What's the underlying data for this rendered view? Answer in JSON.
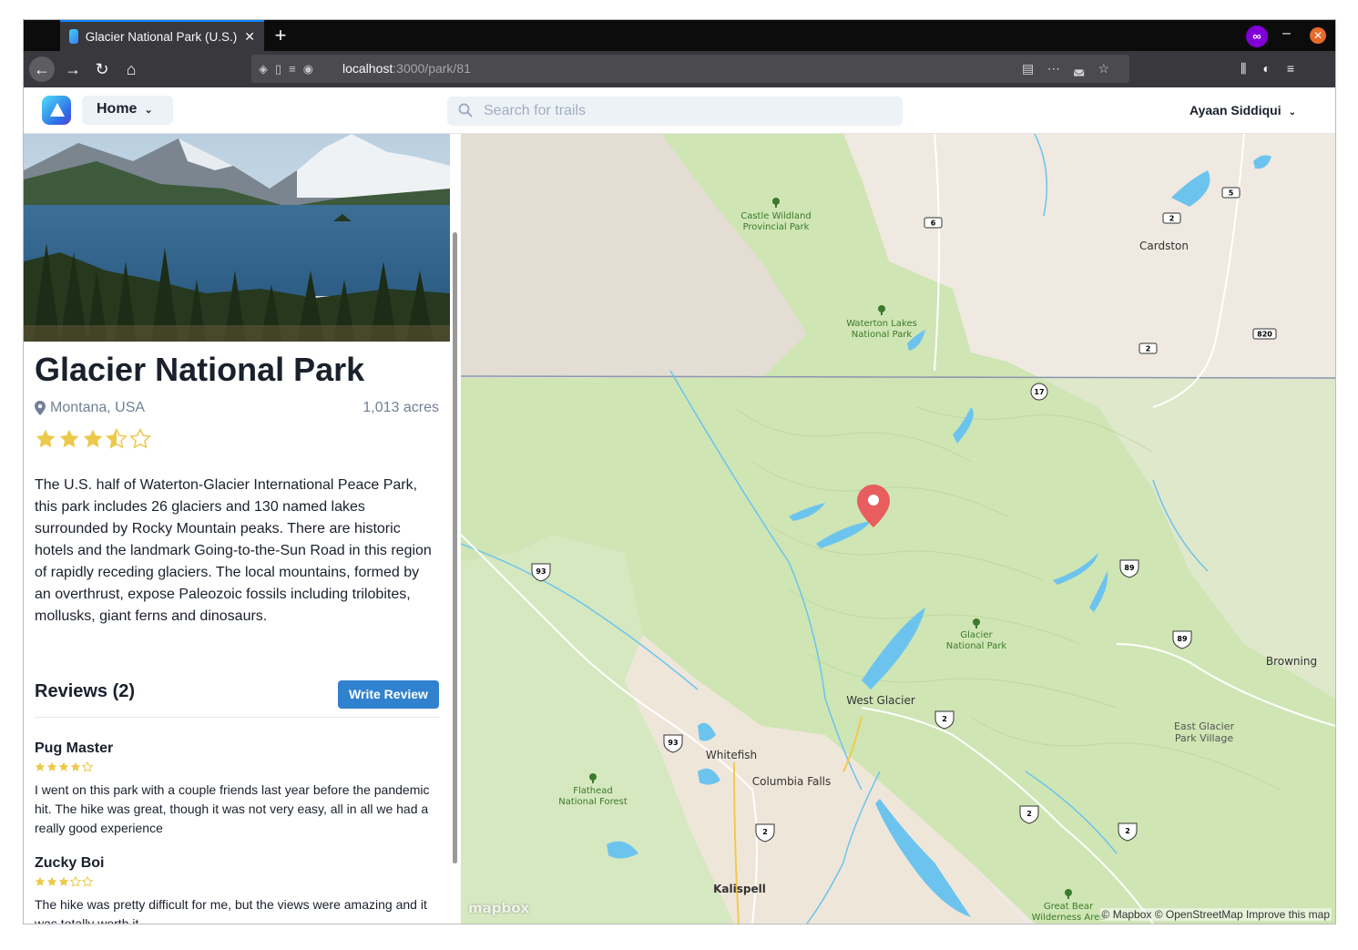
{
  "browser": {
    "tab_title": "Glacier National Park (U.S.)",
    "url_host": "localhost",
    "url_path": ":3000/park/81"
  },
  "header": {
    "home_label": "Home",
    "search_placeholder": "Search for trails",
    "user_name": "Ayaan Siddiqui"
  },
  "park": {
    "name": "Glacier National Park",
    "location": "Montana, USA",
    "acres": "1,013 acres",
    "rating": 3.5,
    "description": "The U.S. half of Waterton-Glacier International Peace Park, this park includes 26 glaciers and 130 named lakes surrounded by Rocky Mountain peaks. There are historic hotels and the landmark Going-to-the-Sun Road in this region of rapidly receding glaciers. The local mountains, formed by an overthrust, expose Paleozoic fossils including trilobites, mollusks, giant ferns and dinosaurs."
  },
  "reviews": {
    "heading": "Reviews (2)",
    "write_label": "Write Review",
    "items": [
      {
        "author": "Pug Master",
        "rating": 4,
        "text": "I went on this park with a couple friends last year before the pandemic hit. The hike was great, though it was not very easy, all in all we had a really good experience"
      },
      {
        "author": "Zucky Boi",
        "rating": 3,
        "text": "The hike was pretty difficult for me, but the views were amazing and it was totally worth it"
      }
    ]
  },
  "map": {
    "labels": {
      "castle": [
        "Castle Wildland",
        "Provincial Park"
      ],
      "waterton": [
        "Waterton Lakes",
        "National Park"
      ],
      "glacier": [
        "Glacier",
        "National Park"
      ],
      "flathead": [
        "Flathead",
        "National Forest"
      ],
      "greatbear": [
        "Great Bear",
        "Wilderness Area"
      ],
      "eastglacier": [
        "East Glacier",
        "Park Village"
      ],
      "cardston": "Cardston",
      "browning": "Browning",
      "westglacier": "West Glacier",
      "whitefish": "Whitefish",
      "columbiafalls": "Columbia Falls",
      "kalispell": "Kalispell"
    },
    "shields": [
      "6",
      "2",
      "5",
      "2",
      "820",
      "17",
      "93",
      "89",
      "89",
      "2",
      "93",
      "2",
      "2",
      "2"
    ],
    "logo": "mapbox",
    "attribution": "© Mapbox © OpenStreetMap Improve this map",
    "colors": {
      "land": "#efe9e1",
      "park": "#cfe5b4",
      "water": "#6cc4ee",
      "marker": "#e85d5d"
    }
  }
}
